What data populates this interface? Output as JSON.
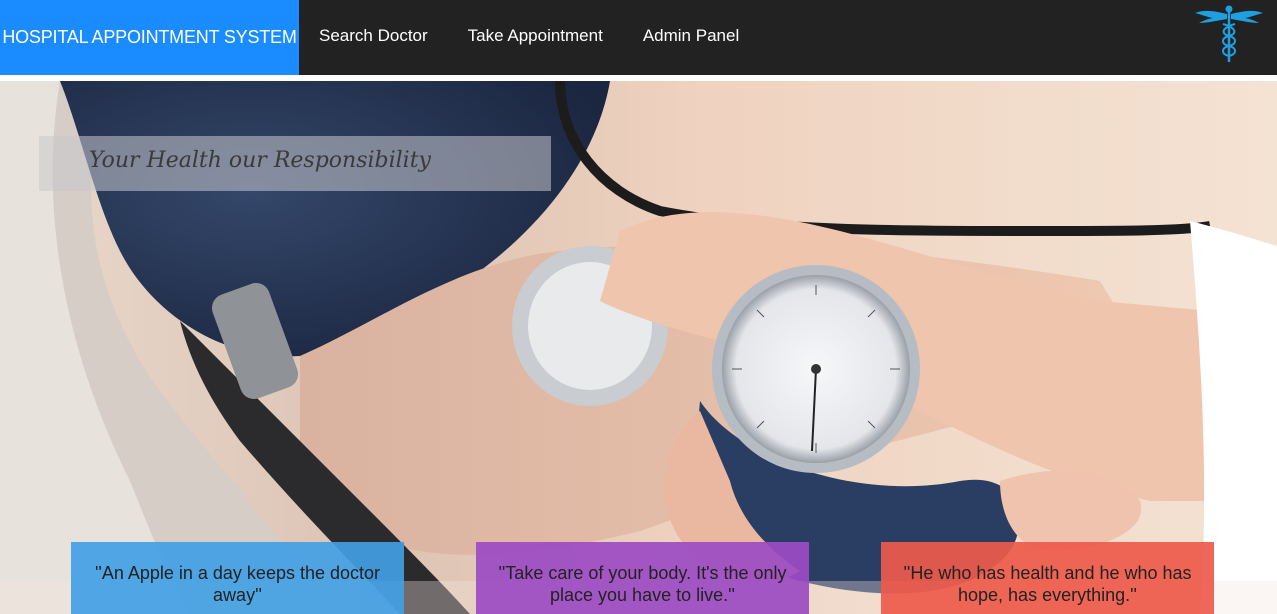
{
  "navbar": {
    "brand": "HOSPITAL APPOINTMENT SYSTEM",
    "links": [
      "Search Doctor",
      "Take Appointment",
      "Admin Panel"
    ],
    "logo_icon": "caduceus-icon",
    "brand_color": "#1a8cff",
    "bar_color": "#222222"
  },
  "hero": {
    "tagline": "Your Health our Responsibility",
    "image": "blood-pressure-measurement-photo"
  },
  "quotes": [
    "''An Apple in a day keeps the doctor away''",
    "''Take care of your body. It's the only place you have to live.''",
    "''He who has health and he who has hope, has everything.''"
  ],
  "quote_colors": [
    "#42a0e4",
    "#9b4bc3",
    "#ee5a4b"
  ]
}
